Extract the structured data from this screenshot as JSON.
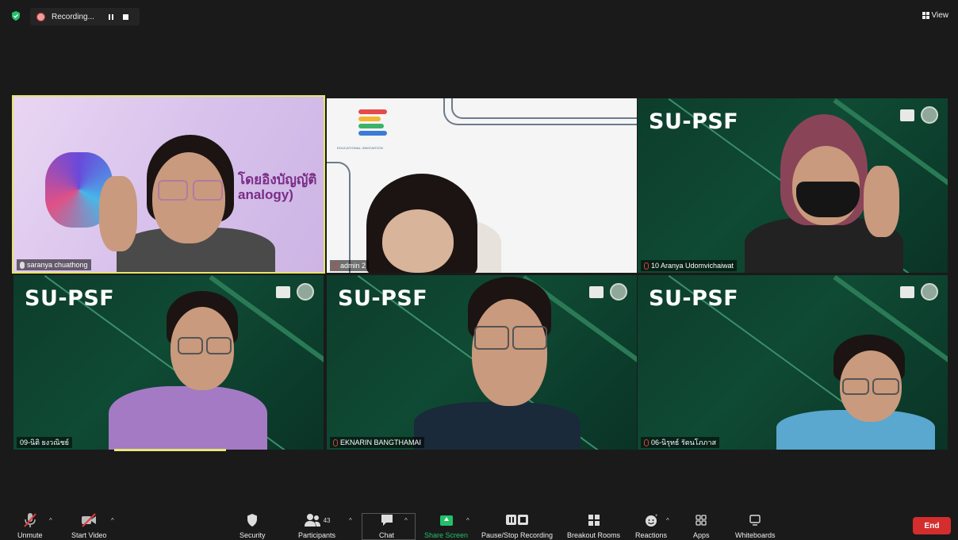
{
  "recording": {
    "label": "Recording..."
  },
  "view": {
    "label": "View"
  },
  "tiles": [
    {
      "name": "saranya chuathong",
      "overlay_text_line1": "โดยอิงบัญญัติ",
      "overlay_text_line2": "analogy)"
    },
    {
      "name": "admin 2",
      "logo_caption": "EDUCATIONAL INNOVATION"
    },
    {
      "name": "10 Aranya Udomvichaiwat",
      "brand": "SU-PSF"
    },
    {
      "name": "09-นิติ ยงวณิชย์",
      "brand": "SU-PSF"
    },
    {
      "name": "EKNARIN BANGTHAMAI",
      "brand": "SU-PSF"
    },
    {
      "name": "06-นิรุทธ์ รัตนโภภาส",
      "brand": "SU-PSF"
    }
  ],
  "toolbar": {
    "unmute": "Unmute",
    "start_video": "Start Video",
    "security": "Security",
    "participants": "Participants",
    "participants_count": "43",
    "chat": "Chat",
    "share_screen": "Share Screen",
    "pause_stop_recording": "Pause/Stop Recording",
    "breakout_rooms": "Breakout Rooms",
    "reactions": "Reactions",
    "apps": "Apps",
    "whiteboards": "Whiteboards",
    "end": "End"
  },
  "colors": {
    "end_red": "#d42d2d",
    "share_green": "#23c06a",
    "active_speaker": "#e5e56a"
  }
}
